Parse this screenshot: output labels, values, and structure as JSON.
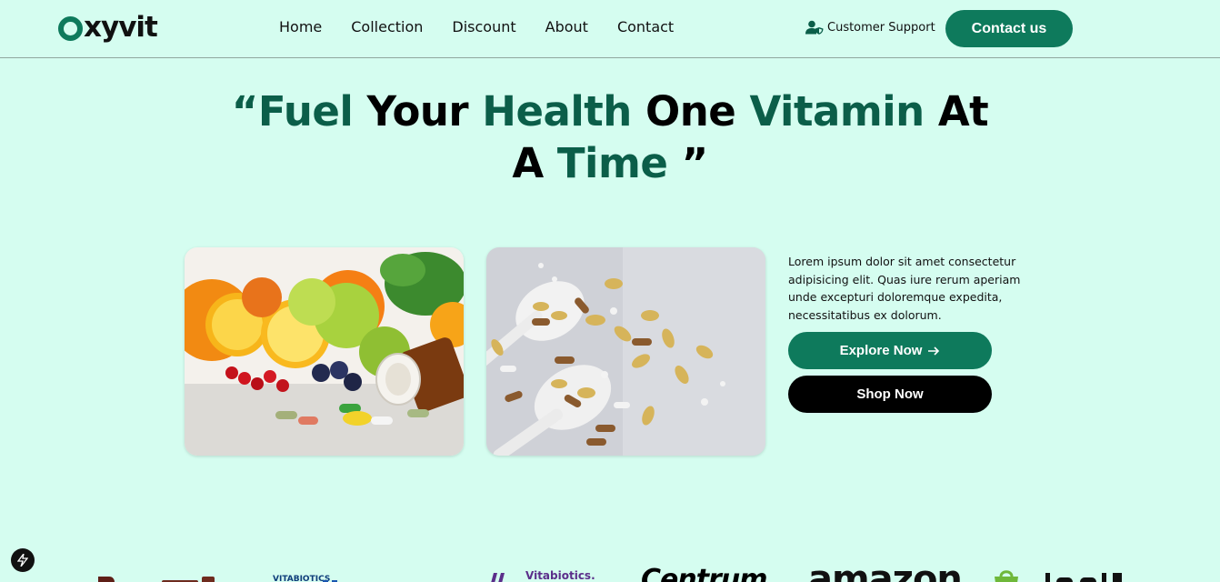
{
  "header": {
    "logo_rest": "xyvit",
    "nav": [
      "Home",
      "Collection",
      "Discount",
      "About",
      "Contact"
    ],
    "support_label": "Customer Support",
    "contact_label": "Contact us"
  },
  "hero": {
    "title_words": [
      {
        "text": "“Fuel",
        "accent": true
      },
      {
        "text": "Your",
        "accent": false
      },
      {
        "text": "Health",
        "accent": true
      },
      {
        "text": "One",
        "accent": false
      },
      {
        "text": "Vitamin",
        "accent": true
      },
      {
        "text": "At",
        "accent": false
      }
    ],
    "title_line2": [
      {
        "text": "A",
        "accent": false
      },
      {
        "text": "Time",
        "accent": true
      },
      {
        "text": "”",
        "accent": false
      }
    ],
    "description": "Lorem ipsum dolor sit amet consectetur adipisicing elit. Quas iure rerum aperiam unde excepturi doloremque expedita, necessitatibus ex dolorum.",
    "explore_label": "Explore Now",
    "shop_label": "Shop Now"
  },
  "brands": {
    "b2_small": "VITABIOTICS",
    "b3_name": "Vitabiotics.",
    "b4": "Centrum",
    "b5": "amazon"
  },
  "colors": {
    "background": "#d5fdf0",
    "accent": "#0e7a5c",
    "heading_accent": "#0b5e49"
  },
  "icons": {
    "support": "user-shield-icon",
    "explore_arrow": "arrow-right-icon",
    "badge": "lightning-icon"
  }
}
